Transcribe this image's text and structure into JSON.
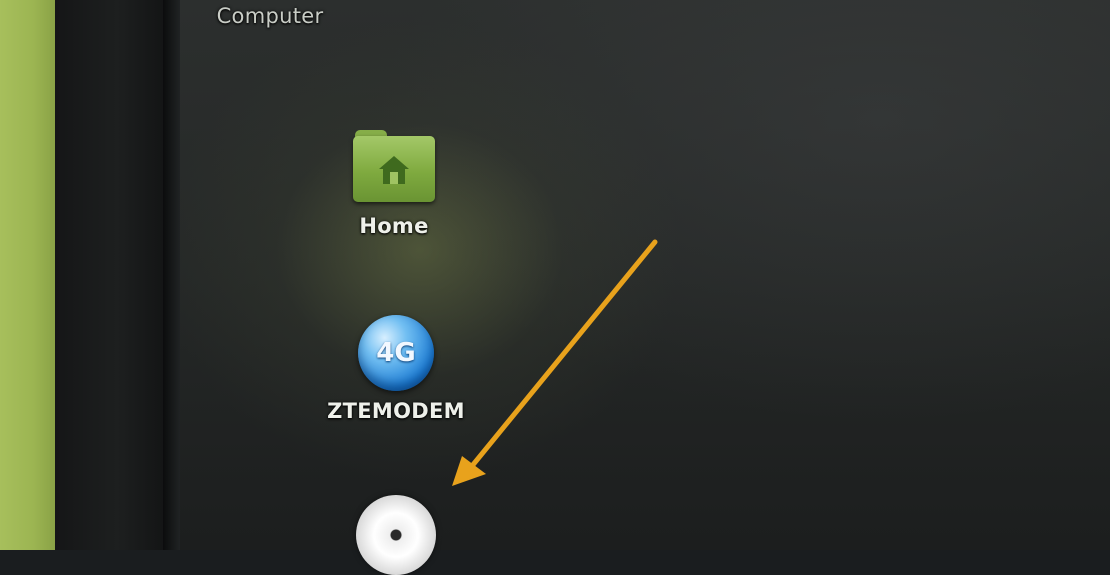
{
  "desktop": {
    "icons": [
      {
        "label": "Computer",
        "icon": "computer-icon"
      },
      {
        "label": "Home",
        "icon": "home-folder-icon"
      },
      {
        "label": "ZTEMODEM",
        "icon": "4g-globe-icon",
        "badge": "4G"
      },
      {
        "label": "",
        "icon": "optical-disc-icon"
      }
    ]
  },
  "annotation": {
    "type": "arrow",
    "color": "#e8a21c",
    "points_to": "optical-disc-icon"
  },
  "colors": {
    "screen_background": "#262928",
    "folder_green": "#7faa3f",
    "wall_green": "#a2bb57"
  }
}
